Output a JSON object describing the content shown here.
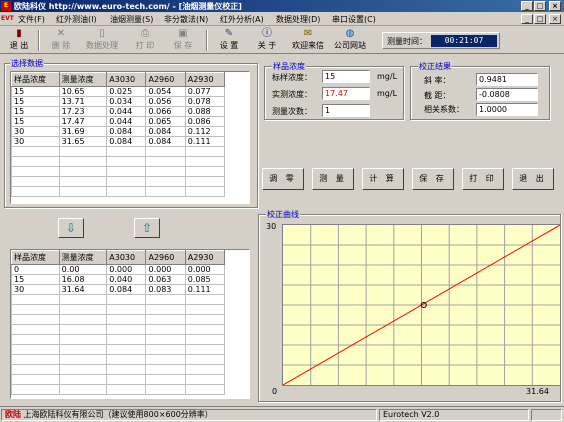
{
  "window": {
    "app_name": "欧陆科仪",
    "url": "http://www.euro-tech.com/",
    "title": "[油烟测量仪校正]"
  },
  "menu": [
    "文件(F)",
    "红外测油(I)",
    "油烟测量(S)",
    "非分散法(N)",
    "红外分析(A)",
    "数据处理(D)",
    "串口设置(C)"
  ],
  "toolbar": {
    "exit": "退 出",
    "delete": "删 除",
    "data_process": "数据处理",
    "print": "打 印",
    "save": "保 存",
    "settings": "设 置",
    "about": "关 于",
    "welcome": "欢迎来信",
    "website": "公司网站"
  },
  "measure_time": {
    "label": "测量时间：",
    "value": "00:21:07"
  },
  "select_data": {
    "title": "选择数据",
    "headers": [
      "样品浓度",
      "测量浓度",
      "A3030",
      "A2960",
      "A2930"
    ],
    "rows": [
      [
        "15",
        "10.65",
        "0.025",
        "0.054",
        "0.077"
      ],
      [
        "15",
        "13.71",
        "0.034",
        "0.056",
        "0.078"
      ],
      [
        "15",
        "17.23",
        "0.044",
        "0.066",
        "0.088"
      ],
      [
        "15",
        "17.47",
        "0.044",
        "0.065",
        "0.086"
      ],
      [
        "30",
        "31.69",
        "0.084",
        "0.084",
        "0.112"
      ],
      [
        "30",
        "31.65",
        "0.084",
        "0.084",
        "0.111"
      ]
    ]
  },
  "selected_data": {
    "headers": [
      "样品浓度",
      "测量浓度",
      "A3030",
      "A2960",
      "A2930"
    ],
    "rows": [
      [
        "0",
        "0.00",
        "0.000",
        "0.000",
        "0.000"
      ],
      [
        "15",
        "16.08",
        "0.040",
        "0.063",
        "0.085"
      ],
      [
        "30",
        "31.64",
        "0.084",
        "0.083",
        "0.111"
      ]
    ]
  },
  "sample": {
    "title": "样品浓度",
    "std_label": "标样浓度：",
    "std_value": "15",
    "std_unit": "mg/L",
    "meas_label": "实测浓度：",
    "meas_value": "17.47",
    "meas_unit": "mg/L",
    "count_label": "测量次数：",
    "count_value": "1"
  },
  "result": {
    "title": "校正结果",
    "slope_label": "斜    率：",
    "slope_value": "0.9481",
    "intercept_label": "截    距：",
    "intercept_value": "-0.0808",
    "corr_label": "相关系数：",
    "corr_value": "1.0000"
  },
  "actions": [
    "调 零",
    "测 量",
    "计 算",
    "保 存",
    "打 印",
    "退 出"
  ],
  "curve": {
    "title": "校正曲线",
    "y_max_label": "30",
    "origin_label": "0",
    "x_max_label": "31.64",
    "line_color": "#ff0000",
    "bg_color": "#ffffc8"
  },
  "chart_data": {
    "type": "line",
    "x": [
      0,
      31.64
    ],
    "y": [
      0,
      30
    ],
    "marker_point": [
      16.08,
      15
    ],
    "xlim": [
      0,
      31.64
    ],
    "ylim": [
      0,
      30
    ],
    "grid": true
  },
  "status": {
    "logo": "欧陆",
    "company": "上海欧陆科仪有限公司（建议使用800×600分辨率）",
    "version": "Eurotech   V2.0"
  }
}
